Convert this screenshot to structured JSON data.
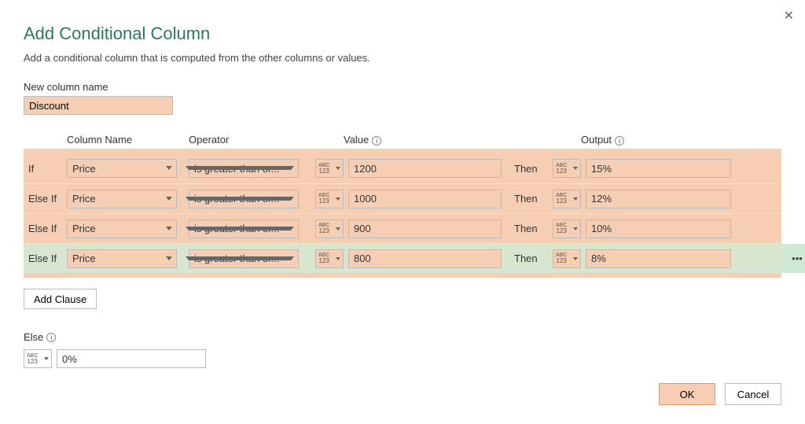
{
  "dialog": {
    "title": "Add Conditional Column",
    "subtitle": "Add a conditional column that is computed from the other columns or values.",
    "new_col_label": "New column name",
    "new_col_value": "Discount"
  },
  "headers": {
    "column_name": "Column Name",
    "operator": "Operator",
    "value": "Value",
    "output": "Output"
  },
  "keywords": {
    "if": "If",
    "elseif": "Else If",
    "then": "Then",
    "else": "Else"
  },
  "type_icon": {
    "top": "ABC",
    "bottom": "123"
  },
  "rules": [
    {
      "kw": "If",
      "col": "Price",
      "op": "is greater than or...",
      "val": "1200",
      "out": "15%",
      "active": false
    },
    {
      "kw": "Else If",
      "col": "Price",
      "op": "is greater than or...",
      "val": "1000",
      "out": "12%",
      "active": false
    },
    {
      "kw": "Else If",
      "col": "Price",
      "op": "is greater than or...",
      "val": "900",
      "out": "10%",
      "active": false
    },
    {
      "kw": "Else If",
      "col": "Price",
      "op": "is greater than or...",
      "val": "800",
      "out": "8%",
      "active": true
    }
  ],
  "else_value": "0%",
  "buttons": {
    "add_clause": "Add Clause",
    "ok": "OK",
    "cancel": "Cancel"
  }
}
